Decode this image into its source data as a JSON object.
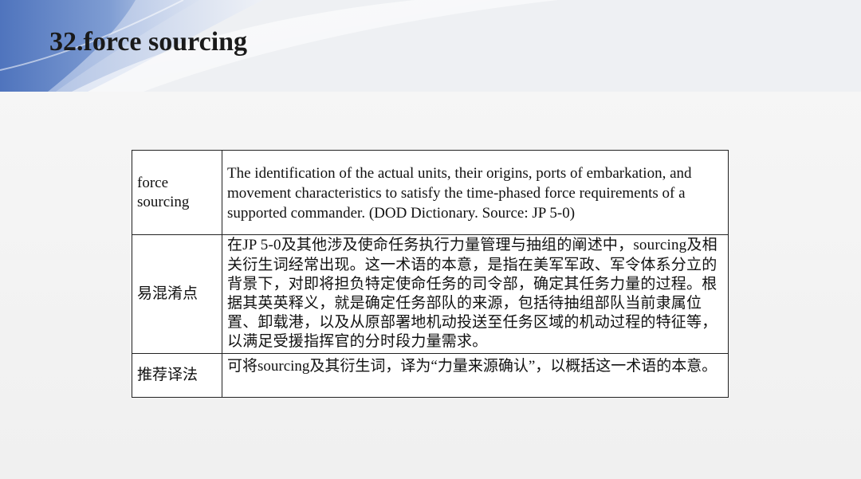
{
  "slide": {
    "title": "32.force sourcing"
  },
  "table": {
    "rows": [
      {
        "label": "force sourcing",
        "content": "The identification of the actual units, their origins, ports of embarkation, and movement characteristics to satisfy the time-phased force requirements of a supported commander. (DOD Dictionary. Source: JP 5-0)"
      },
      {
        "label": "易混淆点",
        "content": "在JP 5-0及其他涉及使命任务执行力量管理与抽组的阐述中，sourcing及相关衍生词经常出现。这一术语的本意，是指在美军军政、军令体系分立的背景下，对即将担负特定使命任务的司令部，确定其任务力量的过程。根据其英英释义，就是确定任务部队的来源，包括待抽组部队当前隶属位置、卸载港，以及从原部署地机动投送至任务区域的机动过程的特征等，以满足受援指挥官的分时段力量需求。"
      },
      {
        "label": "推荐译法",
        "content": "可将sourcing及其衍生词，译为“力量来源确认”，以概括这一术语的本意。"
      }
    ]
  },
  "colors": {
    "header_blue_dark": "#5a7fc4",
    "header_blue_light": "#c9d6ee",
    "border": "#222222",
    "background": "#f2f2f2"
  }
}
